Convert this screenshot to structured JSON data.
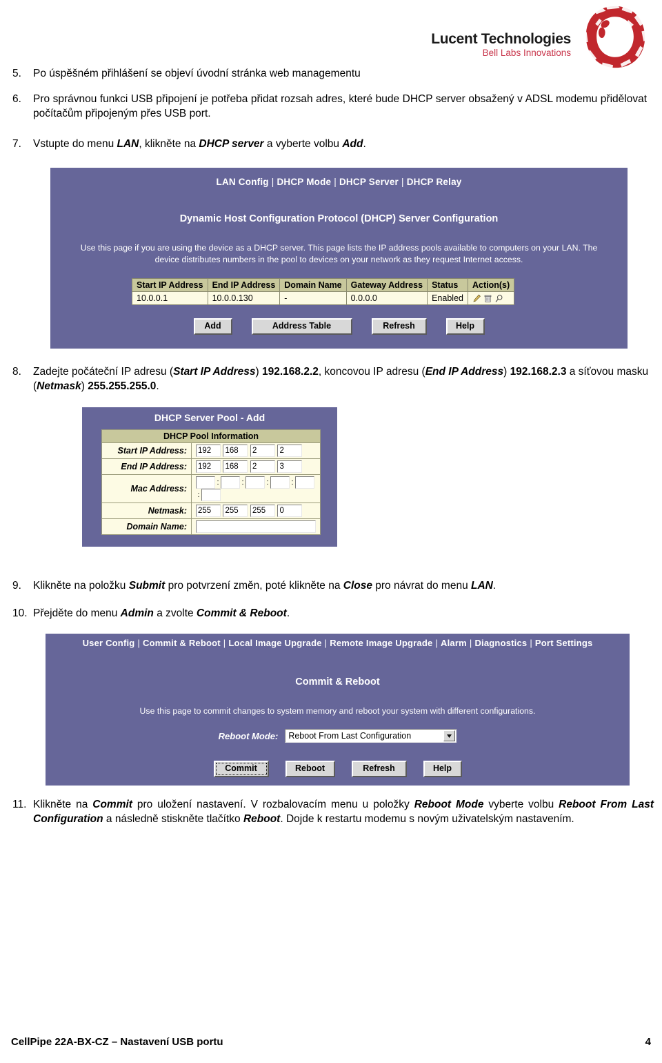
{
  "logo": {
    "title": "Lucent Technologies",
    "subtitle": "Bell Labs Innovations",
    "ring_color": "#c1272d",
    "subtitle_color": "#c8344a"
  },
  "steps": {
    "s5": {
      "num": "5.",
      "text": "Po úspěšném přihlášení se objeví úvodní stránka web managementu"
    },
    "s6": {
      "num": "6.",
      "text": "Pro správnou funkci USB připojení je potřeba přidat rozsah adres, které bude DHCP server obsažený v ADSL modemu přidělovat počítačům připojeným přes USB port."
    },
    "s7": {
      "num": "7.",
      "p1": "Vstupte do menu ",
      "b1": "LAN",
      "p2": ", klikněte na ",
      "b2": "DHCP server",
      "p3": " a vyberte volbu ",
      "b3": "Add",
      "p4": "."
    },
    "s8": {
      "num": "8.",
      "p1": "Zadejte počáteční IP adresu (",
      "b1": "Start IP Address",
      "p2": ") ",
      "v1": "192.168.2.2",
      "p3": ", koncovou IP adresu (",
      "b2": "End IP Address",
      "p4": ") ",
      "v2": "192.168.2.3",
      "p5": " a síťovou masku (",
      "b3": "Netmask",
      "p6": ") ",
      "v3": "255.255.255.0",
      "p7": "."
    },
    "s9": {
      "num": "9.",
      "p1": "Klikněte na položku ",
      "b1": "Submit",
      "p2": " pro potvrzení změn, poté klikněte na ",
      "b2": "Close",
      "p3": " pro návrat do menu ",
      "b3": "LAN",
      "p4": "."
    },
    "s10": {
      "num": "10.",
      "p1": "Přejděte do menu ",
      "b1": "Admin",
      "p2": " a zvolte ",
      "b2": "Commit & Reboot",
      "p3": "."
    },
    "s11": {
      "num": "11.",
      "p1": "Klikněte na ",
      "b1": "Commit",
      "p2": " pro uložení nastavení. V rozbalovacím menu u položky ",
      "b2": "Reboot Mode",
      "p3": " vyberte volbu ",
      "b3": "Reboot From Last Configuration",
      "p4": " a následně stiskněte tlačítko ",
      "b4": "Reboot",
      "p5": ". Dojde k restartu modemu s novým uživatelským nastavením."
    }
  },
  "dhcp_server_panel": {
    "bg_color": "#666699",
    "nav": [
      "LAN Config",
      "DHCP Mode",
      "DHCP Server",
      "DHCP Relay"
    ],
    "heading": "Dynamic Host Configuration Protocol (DHCP) Server Configuration",
    "description": "Use this page if you are using the device as a DHCP server. This page lists the IP address pools available to computers on your LAN. The device distributes numbers in the pool to devices on your network as they request Internet access.",
    "table": {
      "columns": [
        "Start IP Address",
        "End IP Address",
        "Domain Name",
        "Gateway Address",
        "Status",
        "Action(s)"
      ],
      "rows": [
        {
          "start_ip": "10.0.0.1",
          "end_ip": "10.0.0.130",
          "domain_name": "-",
          "gateway": "0.0.0.0",
          "status": "Enabled",
          "actions": [
            "edit-pencil-icon",
            "delete-trash-icon",
            "view-magnifier-icon"
          ]
        }
      ]
    },
    "buttons": [
      "Add",
      "Address Table",
      "Refresh",
      "Help"
    ]
  },
  "dhcp_pool_add_panel": {
    "bg_color": "#666699",
    "title": "DHCP Server Pool - Add",
    "section_header": "DHCP Pool Information",
    "fields": {
      "start_ip_label": "Start IP Address:",
      "start_ip": [
        "192",
        "168",
        "2",
        "2"
      ],
      "end_ip_label": "End IP Address:",
      "end_ip": [
        "192",
        "168",
        "2",
        "3"
      ],
      "mac_label": "Mac Address:",
      "mac": [
        "",
        "",
        "",
        "",
        "",
        ""
      ],
      "netmask_label": "Netmask:",
      "netmask": [
        "255",
        "255",
        "255",
        "0"
      ],
      "domain_label": "Domain Name:",
      "domain": ""
    }
  },
  "commit_reboot_panel": {
    "bg_color": "#666699",
    "nav": [
      "User Config",
      "Commit & Reboot",
      "Local Image Upgrade",
      "Remote Image Upgrade",
      "Alarm",
      "Diagnostics",
      "Port Settings"
    ],
    "heading": "Commit & Reboot",
    "description": "Use this page to commit changes to system memory and reboot your system with different configurations.",
    "reboot_mode_label": "Reboot Mode:",
    "reboot_mode_value": "Reboot From Last Configuration",
    "buttons": [
      "Commit",
      "Reboot",
      "Refresh",
      "Help"
    ]
  },
  "footer": {
    "left": "CellPipe 22A-BX-CZ – Nastavení USB portu",
    "page": "4"
  }
}
